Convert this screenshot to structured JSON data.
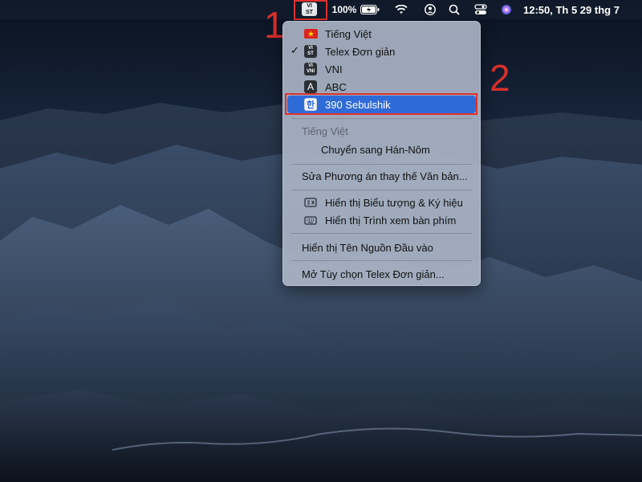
{
  "menubar": {
    "input_source_abbr_top": "VI",
    "input_source_abbr_bottom": "ST",
    "battery_percent": "100%",
    "clock": "12:50, Th 5 29 thg 7",
    "icons": [
      "battery-charging-icon",
      "wifi-icon",
      "user-account-icon",
      "spotlight-search-icon",
      "control-center-icon",
      "siri-icon"
    ]
  },
  "annotations": {
    "step_1": "1",
    "step_2": "2",
    "highlight_color": "#e0322b"
  },
  "input_menu": {
    "sources": [
      {
        "label": "Tiếng Việt",
        "icon": "vietnam-flag-icon",
        "checked": false
      },
      {
        "label": "Telex Đơn giản",
        "icon": "vi-st-icon",
        "checked": true
      },
      {
        "label": "VNI",
        "icon": "vi-vni-icon",
        "checked": false
      },
      {
        "label": "ABC",
        "icon": "abc-letter-icon",
        "checked": false
      },
      {
        "label": "390 Sebulshik",
        "icon": "korean-han-icon",
        "checked": false,
        "selected": true
      }
    ],
    "section_header": "Tiếng Việt",
    "convert_item": "Chuyển sang Hán-Nôm",
    "edit_text_replacement": "Sửa Phương án thay thế Văn bản...",
    "show_emoji_symbols": "Hiển thị Biểu tượng & Ký hiệu",
    "show_keyboard_viewer": "Hiển thị Trình xem bàn phím",
    "show_input_source_name": "Hiển thị Tên Nguồn Đầu vào",
    "open_preferences": "Mở Tùy chọn Telex Đơn giản...",
    "selection_color": "#2f6bd8"
  },
  "icon_glyphs": {
    "checkmark": "✓",
    "han": "한",
    "a_letter": "A",
    "vi": "VI",
    "st": "ST",
    "vni": "VNI"
  }
}
